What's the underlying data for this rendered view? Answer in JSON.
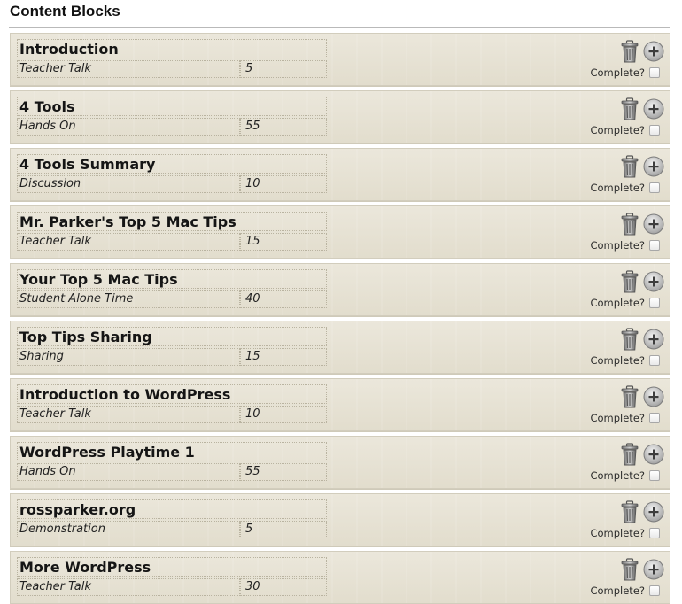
{
  "page": {
    "title": "Content Blocks"
  },
  "labels": {
    "complete": "Complete?"
  },
  "icons": {
    "delete": "trash-icon",
    "add": "plus-circle-icon"
  },
  "colors": {
    "block_background": "#e6e1d2",
    "block_border": "#d2cdbd",
    "field_border": "#b9b3a0"
  },
  "blocks": [
    {
      "title": "Introduction",
      "type": "Teacher Talk",
      "minutes": "5",
      "complete": false
    },
    {
      "title": "4 Tools",
      "type": "Hands On",
      "minutes": "55",
      "complete": false
    },
    {
      "title": "4 Tools Summary",
      "type": "Discussion",
      "minutes": "10",
      "complete": false
    },
    {
      "title": "Mr. Parker's Top 5 Mac Tips",
      "type": "Teacher Talk",
      "minutes": "15",
      "complete": false
    },
    {
      "title": "Your Top 5 Mac Tips",
      "type": "Student Alone Time",
      "minutes": "40",
      "complete": false
    },
    {
      "title": "Top Tips Sharing",
      "type": "Sharing",
      "minutes": "15",
      "complete": false
    },
    {
      "title": "Introduction to WordPress",
      "type": "Teacher Talk",
      "minutes": "10",
      "complete": false
    },
    {
      "title": "WordPress Playtime 1",
      "type": "Hands On",
      "minutes": "55",
      "complete": false
    },
    {
      "title": "rossparker.org",
      "type": "Demonstration",
      "minutes": "5",
      "complete": false
    },
    {
      "title": "More WordPress",
      "type": "Teacher Talk",
      "minutes": "30",
      "complete": false
    }
  ]
}
